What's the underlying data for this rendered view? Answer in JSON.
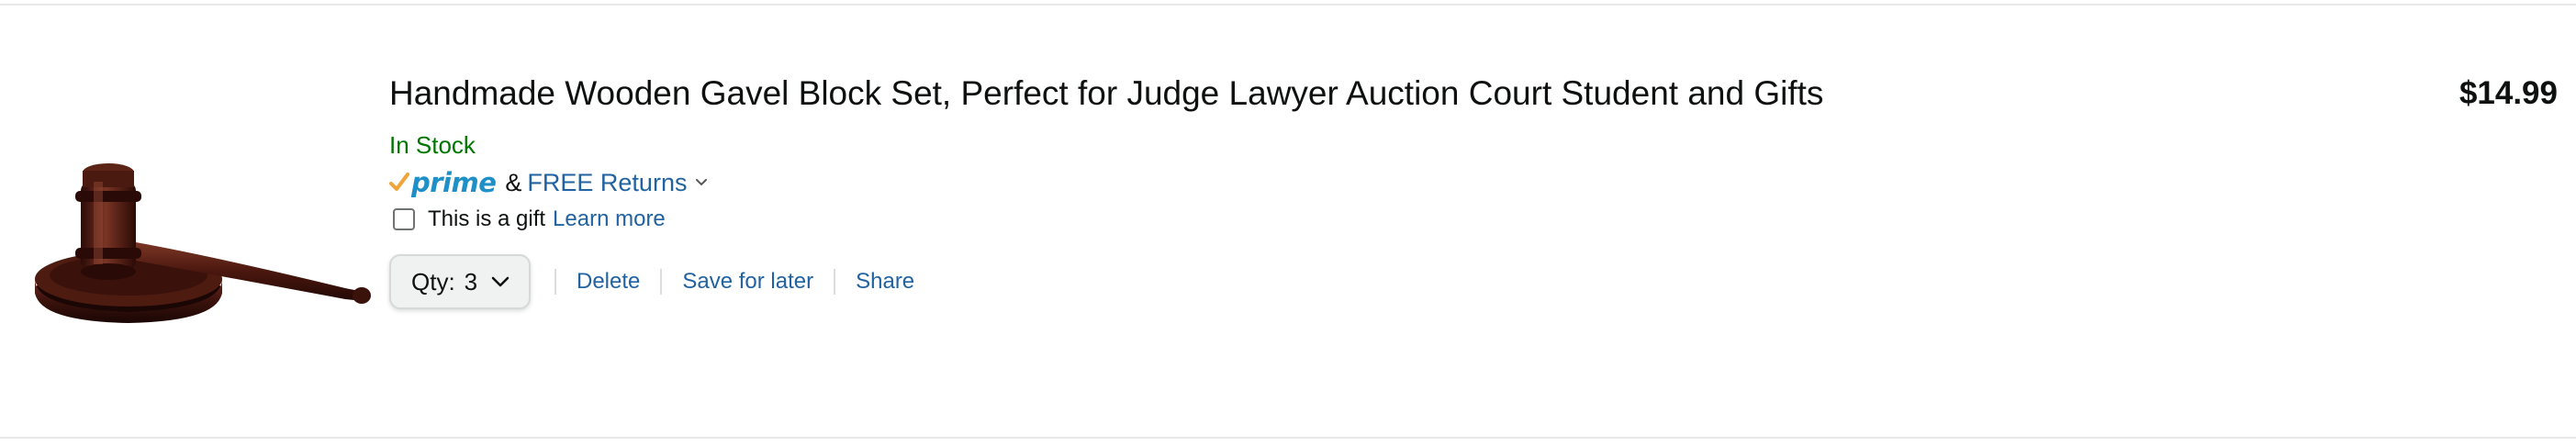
{
  "cart_item": {
    "image_alt": "Wooden gavel and sound block",
    "title": "Handmade Wooden Gavel Block Set, Perfect for Judge Lawyer Auction Court Student and Gifts",
    "stock_status": "In Stock",
    "prime": {
      "logo_text": "prime",
      "ampersand": "&",
      "returns_label": "FREE Returns"
    },
    "gift": {
      "label": "This is a gift",
      "learn_more": "Learn more",
      "checked": false
    },
    "quantity": {
      "label": "Qty:",
      "value": "3"
    },
    "actions": {
      "delete": "Delete",
      "save_for_later": "Save for later",
      "share": "Share"
    },
    "price": "$14.99"
  },
  "colors": {
    "in_stock": "#007600",
    "link": "#2162a1",
    "prime_blue": "#1f8fc8",
    "prime_check": "#f0a43a"
  },
  "icons": {
    "returns_chevron": "chevron-down-icon",
    "qty_chevron": "chevron-down-icon",
    "prime_check": "check-icon"
  }
}
